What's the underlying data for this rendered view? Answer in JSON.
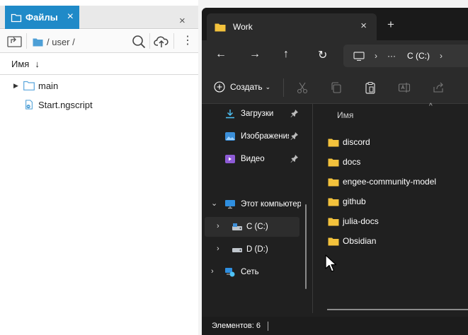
{
  "left_panel": {
    "tab_label": "Файлы",
    "tab_close": "×",
    "panel_close": "×",
    "path": "/ user /",
    "more": "⋮",
    "header_label": "Имя",
    "sort_arrow": "↓",
    "items": [
      {
        "label": "main",
        "type": "folder",
        "expander": "▶"
      },
      {
        "label": "Start.ngscript",
        "type": "script"
      }
    ]
  },
  "explorer": {
    "tab_title": "Work",
    "tab_close": "×",
    "new_tab": "+",
    "nav": {
      "back": "←",
      "forward": "→",
      "up": "↑",
      "refresh": "↻"
    },
    "address": {
      "chevron": "›",
      "ellipsis": "···",
      "drive": "C (C:)"
    },
    "create_label": "Создать",
    "create_caret": "⌄",
    "nav_pane": [
      {
        "label": "Загрузки",
        "icon": "download-icon",
        "pinned": true
      },
      {
        "label": "Изображения",
        "icon": "pictures-icon",
        "pinned": true
      },
      {
        "label": "Видео",
        "icon": "video-icon",
        "pinned": true
      },
      {
        "label": "Этот компьютер",
        "icon": "computer-icon",
        "expander": "⌄"
      },
      {
        "label": "C (C:)",
        "icon": "drive-c-icon",
        "expander": "›",
        "selected": true
      },
      {
        "label": "D (D:)",
        "icon": "drive-d-icon",
        "expander": "›"
      },
      {
        "label": "Сеть",
        "icon": "network-icon",
        "expander": "›"
      }
    ],
    "column_header": "Имя",
    "column_sort": "^",
    "files": [
      "discord",
      "docs",
      "engee-community-model",
      "github",
      "julia-docs",
      "Obsidian"
    ],
    "status": "Элементов: 6"
  },
  "colors": {
    "accent_blue": "#1f8ac8",
    "folder_yellow": "#f3c23c",
    "explorer_bg": "#202020"
  }
}
